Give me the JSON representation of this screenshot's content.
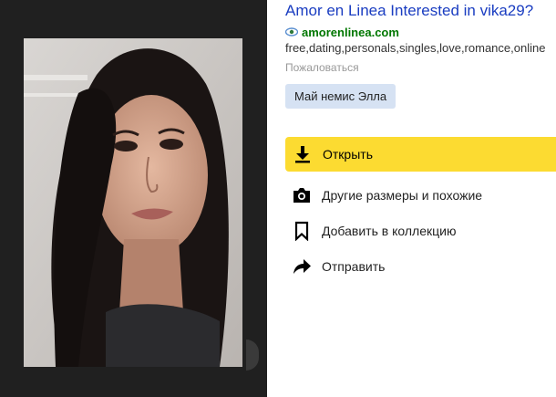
{
  "result": {
    "title": "Amor en Linea Interested in vika29?",
    "domain": "amorenlinea.com",
    "keywords": "free,dating,personals,singles,love,romance,online",
    "report_link": "Пожаловаться",
    "tag": "Май немис Элла"
  },
  "actions": {
    "open": "Открыть",
    "similar": "Другие размеры и похожие",
    "collection": "Добавить в коллекцию",
    "share": "Отправить"
  },
  "colors": {
    "viewer_bg": "#202020",
    "title_link": "#1a3dc1",
    "domain_green": "#007700",
    "open_button": "#fcdb31",
    "tag_bg": "#d6e2f3"
  },
  "icons": {
    "domain": "domain-eye-icon",
    "open": "download-icon",
    "similar": "camera-icon",
    "collection": "bookmark-icon",
    "share": "share-arrow-icon"
  }
}
